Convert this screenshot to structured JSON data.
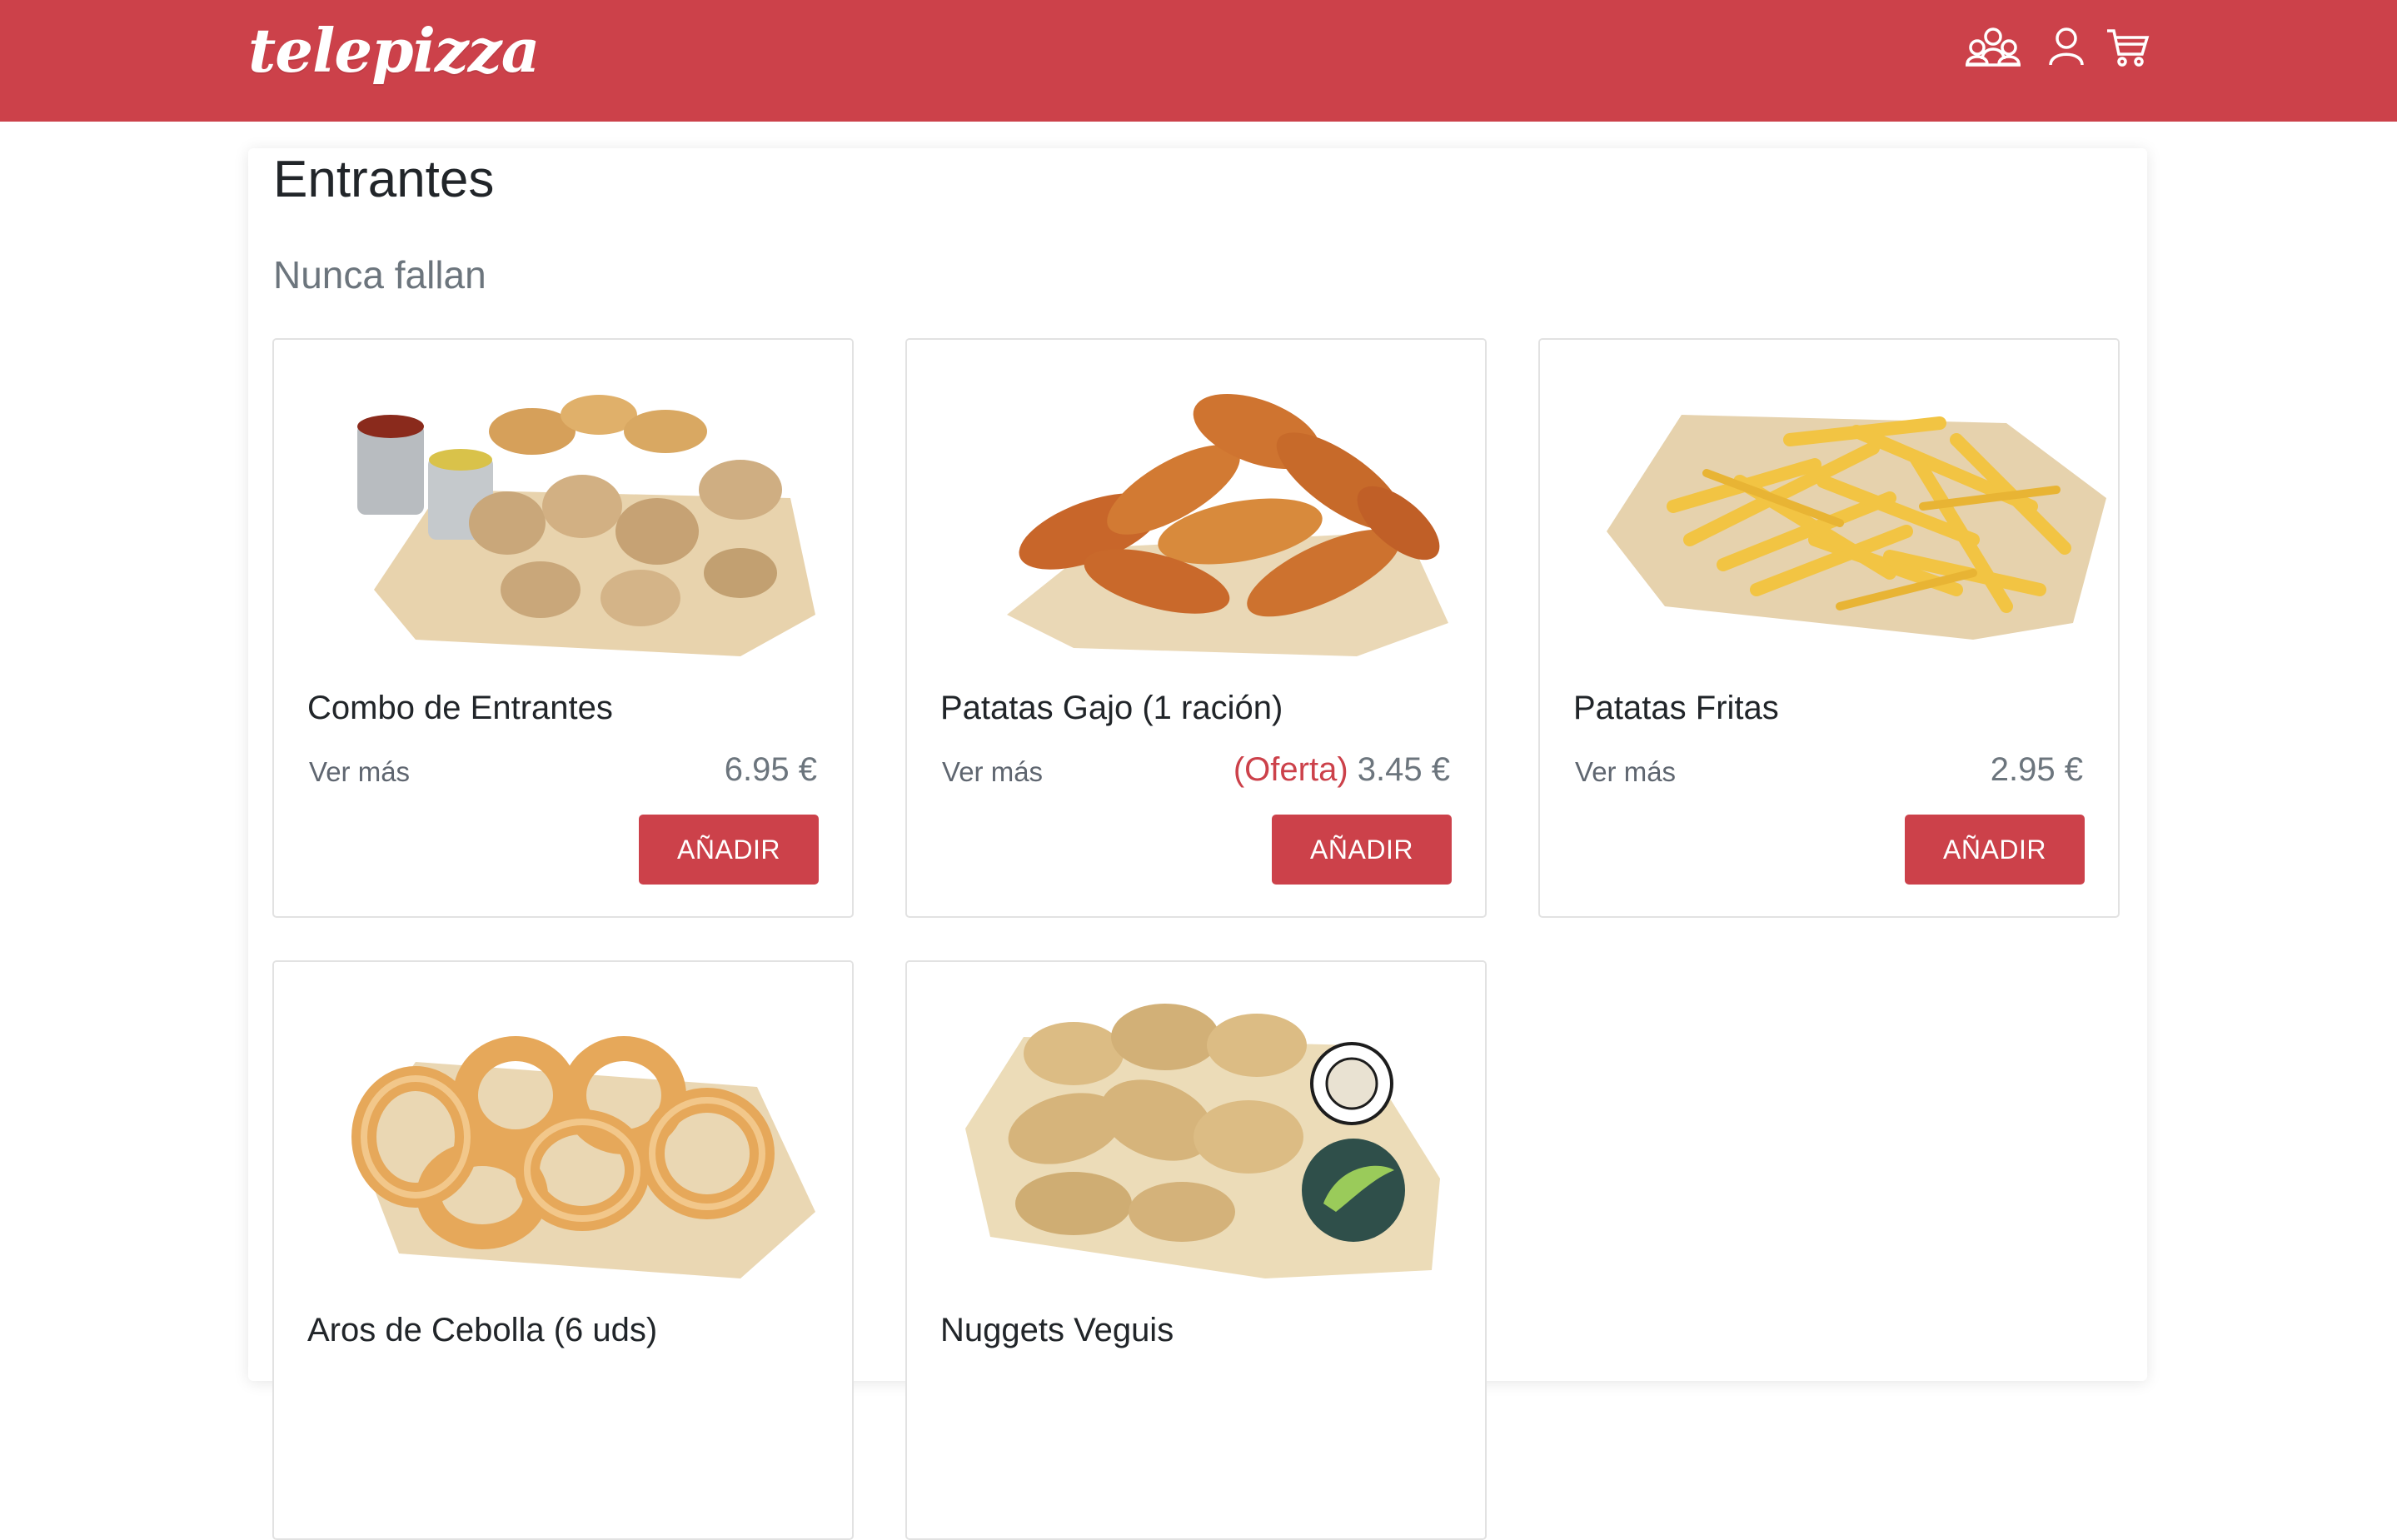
{
  "header": {
    "logo_text": "telepizza",
    "brand_color": "#cc414a",
    "icons": [
      "groups-icon",
      "user-icon",
      "cart-icon"
    ]
  },
  "page": {
    "title": "Entrantes",
    "section": "Nunca fallan"
  },
  "products": [
    {
      "name": "Combo de Entrantes",
      "more": "Ver más",
      "offer": "",
      "price": "6.95 €",
      "button": "AÑADIR"
    },
    {
      "name": "Patatas Gajo (1 ración)",
      "more": "Ver más",
      "offer": "(Oferta)",
      "price": "3.45 €",
      "button": "AÑADIR"
    },
    {
      "name": "Patatas Fritas",
      "more": "Ver más",
      "offer": "",
      "price": "2.95 €",
      "button": "AÑADIR"
    },
    {
      "name": "Aros de Cebolla (6 uds)"
    },
    {
      "name": "Nuggets Veguis"
    }
  ]
}
